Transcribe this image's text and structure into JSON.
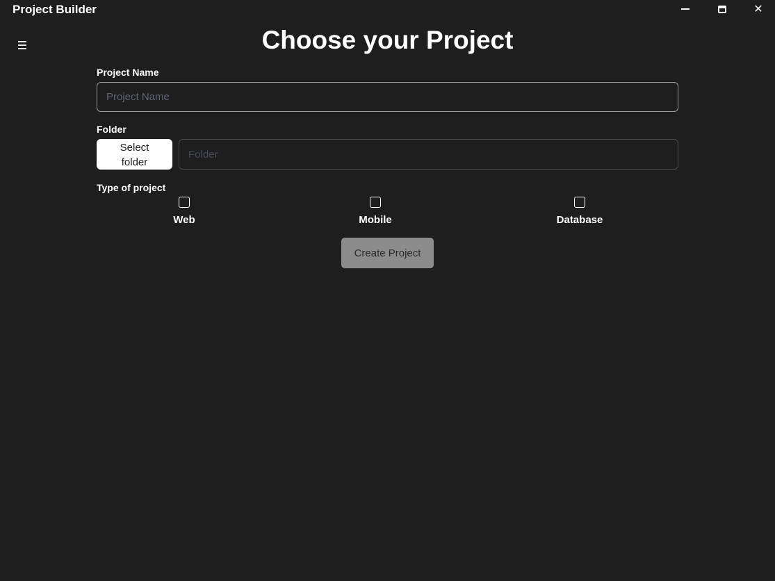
{
  "window": {
    "title": "Project Builder",
    "controls": {
      "minimize_icon": "minimize-icon",
      "maximize_icon": "maximize-icon",
      "close_icon": "close-icon",
      "close_glyph": "✕"
    }
  },
  "nav": {
    "menu_icon": "hamburger-menu-icon"
  },
  "page": {
    "heading": "Choose your Project"
  },
  "form": {
    "project_name": {
      "label": "Project Name",
      "placeholder": "Project Name",
      "value": ""
    },
    "folder": {
      "label": "Folder",
      "button_label": "Select folder",
      "placeholder": "Folder",
      "value": ""
    },
    "project_type": {
      "label": "Type of project",
      "options": [
        {
          "label": "Web",
          "checked": false
        },
        {
          "label": "Mobile",
          "checked": false
        },
        {
          "label": "Database",
          "checked": false
        }
      ]
    },
    "submit": {
      "label": "Create Project",
      "enabled": false
    }
  },
  "colors": {
    "background": "#1e1e1e",
    "text": "#ffffff",
    "input_border": "#9c9c9c",
    "placeholder": "#5e6473",
    "select_button_bg": "#ffffff",
    "create_button_bg": "#8c8c8c"
  }
}
